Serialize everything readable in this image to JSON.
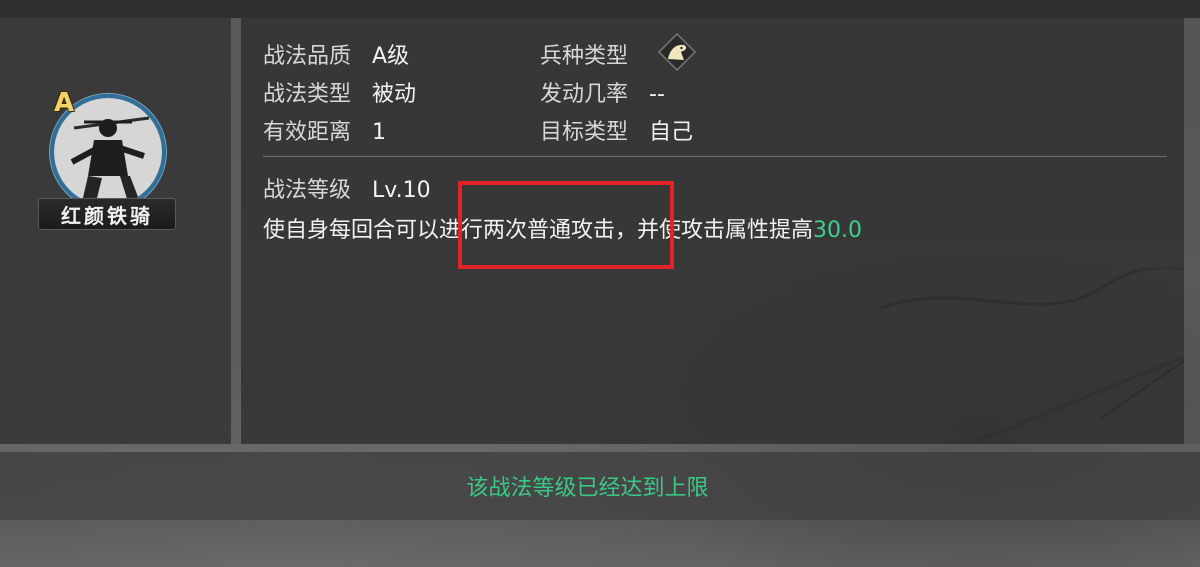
{
  "skill": {
    "grade": "A",
    "name": "红颜铁骑",
    "icon": "cavalry-warrior-portrait"
  },
  "attributes": {
    "quality_label": "战法品质",
    "quality_value": "A级",
    "type_label": "战法类型",
    "type_value": "被动",
    "range_label": "有效距离",
    "range_value": "1",
    "troop_label": "兵种类型",
    "troop_icon": "horse-head-icon",
    "trigger_label": "发动几率",
    "trigger_value": "--",
    "target_label": "目标类型",
    "target_value": "自己"
  },
  "level": {
    "label": "战法等级",
    "value": "Lv.10"
  },
  "description": {
    "text": "使自身每回合可以进行两次普通攻击，并使攻击属性提高",
    "highlight_value": "30.0",
    "highlight_color": "#3fd08b"
  },
  "footer": {
    "message": "该战法等级已经达到上限",
    "message_color": "#39c985"
  },
  "annotation": {
    "box_color": "#e3222a"
  }
}
